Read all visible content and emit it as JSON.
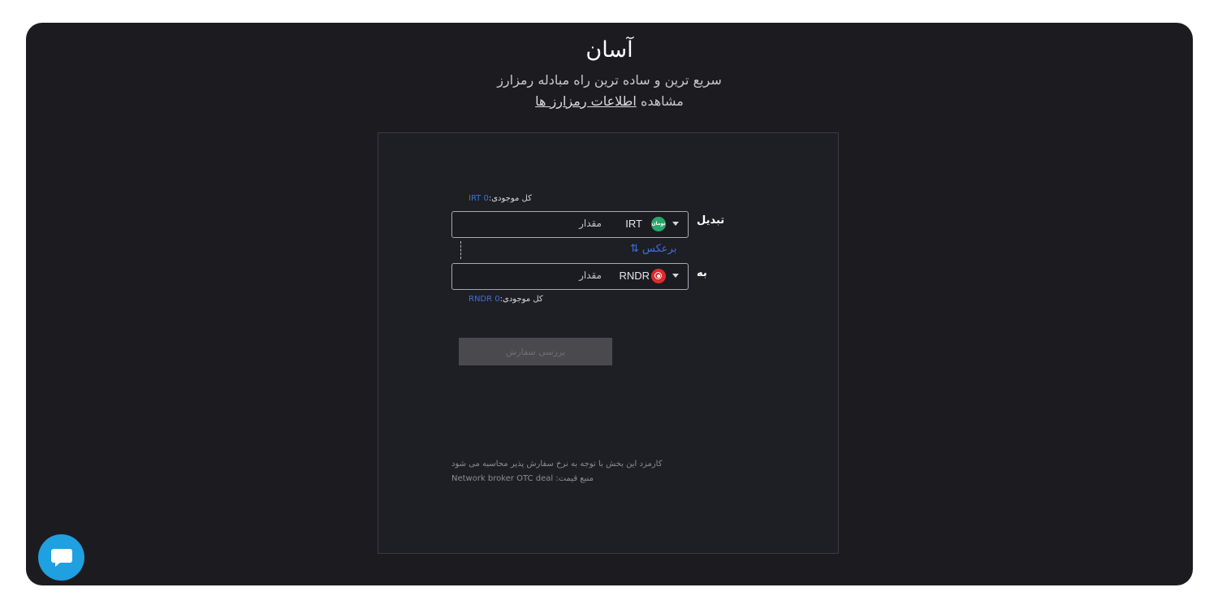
{
  "header": {
    "title": "آسان",
    "subtitle": "سریع ترین و ساده ترین راه مبادله رمزارز",
    "info_prefix": "مشاهده",
    "info_link": "اطلاعات رمزارز ها"
  },
  "form": {
    "from": {
      "label": "تبدیل",
      "balance_label": "کل موجودی:",
      "balance_value": "0 IRT",
      "coin": "IRT",
      "coin_icon_text": "تومان",
      "icon": "toman-icon",
      "amount_placeholder": "مقدار"
    },
    "reverse_label": "برعکس",
    "reverse_icon": "swap-vertical-icon",
    "to": {
      "label": "به",
      "balance_label": "کل موجودی:",
      "balance_value": "0 RNDR",
      "coin": "RNDR",
      "icon": "rndr-icon",
      "amount_placeholder": "مقدار"
    },
    "submit_label": "بررسی سفارش"
  },
  "notes": {
    "fee": "کارمزد این بخش با توجه به نرخ سفارش پذیر محاسبه می شود",
    "source_label": "منبع قیمت:",
    "source_value": "Network broker OTC deal"
  },
  "chat": {
    "icon": "chat-icon"
  },
  "colors": {
    "background": "#1c1c20",
    "accent": "#3d6fe0",
    "chat": "#1fa0e0",
    "toman": "#2aa86a",
    "rndr": "#e02b2b"
  }
}
